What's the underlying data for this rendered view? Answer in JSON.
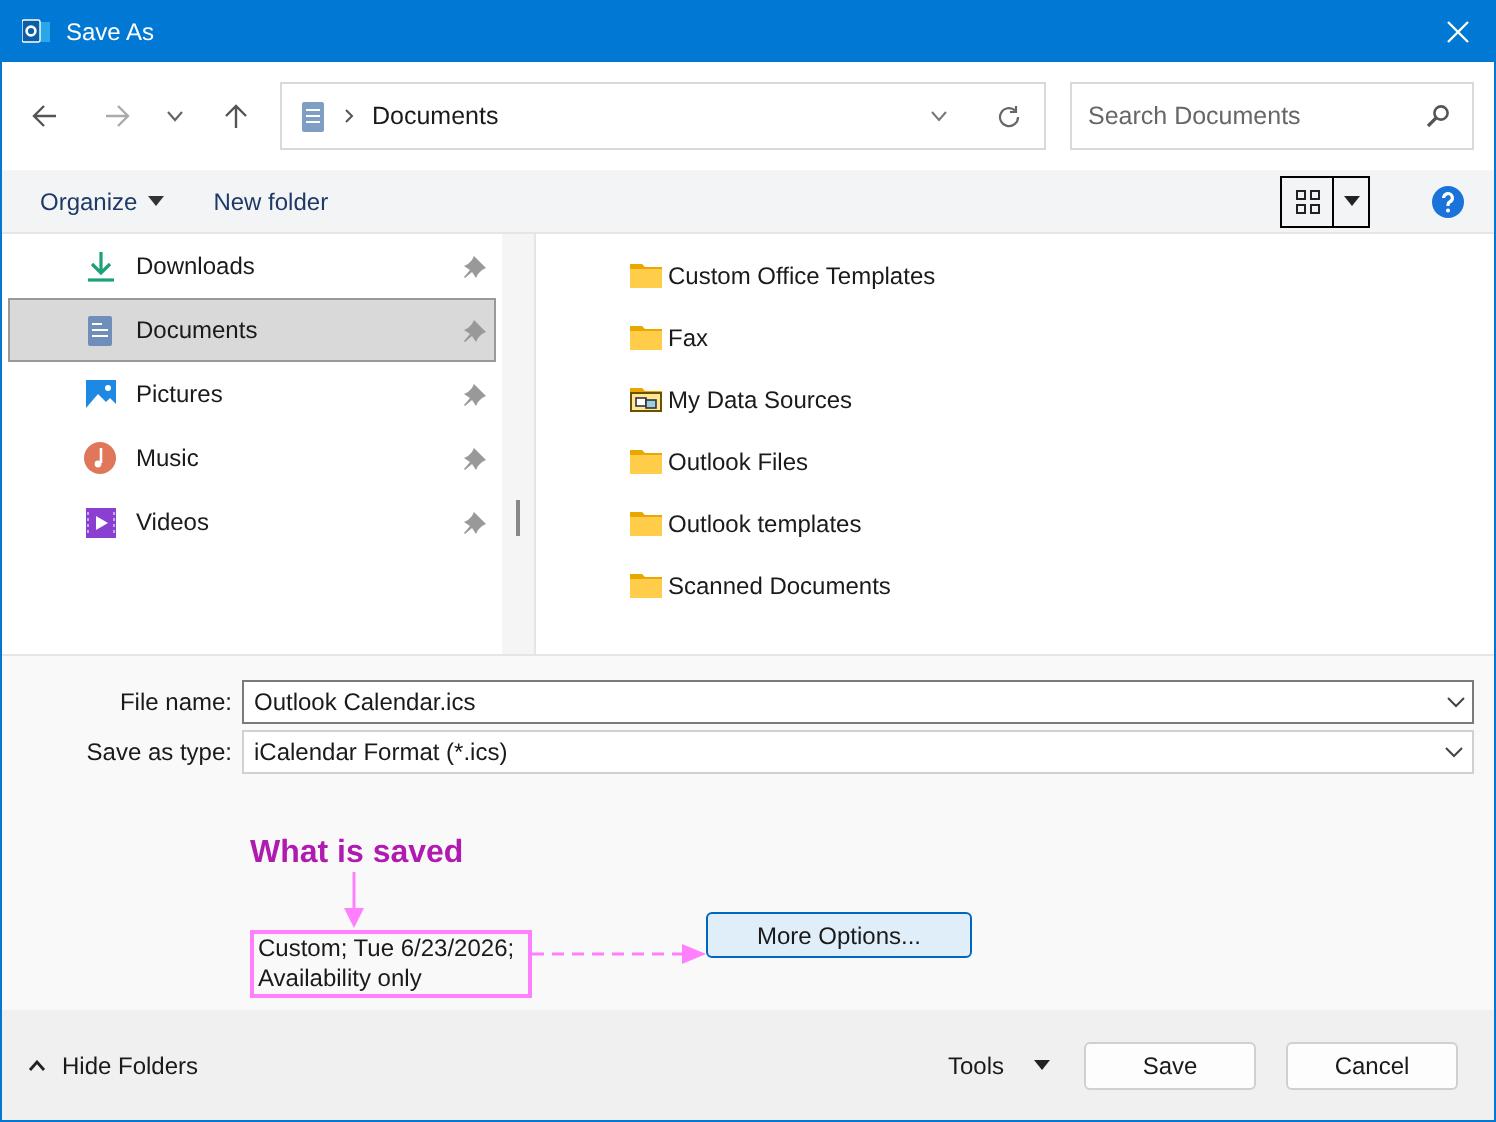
{
  "window": {
    "title": "Save As"
  },
  "address_bar": {
    "path": "Documents"
  },
  "search": {
    "placeholder": "Search Documents"
  },
  "toolbar": {
    "organize": "Organize",
    "new_folder": "New folder"
  },
  "sidebar": {
    "items": [
      {
        "label": "Downloads",
        "kind": "downloads",
        "selected": false
      },
      {
        "label": "Documents",
        "kind": "documents",
        "selected": true
      },
      {
        "label": "Pictures",
        "kind": "pictures",
        "selected": false
      },
      {
        "label": "Music",
        "kind": "music",
        "selected": false
      },
      {
        "label": "Videos",
        "kind": "videos",
        "selected": false
      }
    ]
  },
  "files": [
    {
      "name": "Custom Office Templates",
      "kind": "folder"
    },
    {
      "name": "Fax",
      "kind": "folder"
    },
    {
      "name": "My Data Sources",
      "kind": "data-folder"
    },
    {
      "name": "Outlook Files",
      "kind": "folder"
    },
    {
      "name": "Outlook templates",
      "kind": "folder"
    },
    {
      "name": "Scanned Documents",
      "kind": "folder"
    }
  ],
  "file_name": {
    "label": "File name:",
    "value": "Outlook Calendar.ics"
  },
  "save_as_type": {
    "label": "Save as type:",
    "value": "iCalendar Format (*.ics)"
  },
  "annotation": {
    "text": "What is saved"
  },
  "summary": "Custom; Tue 6/23/2026; Availability only",
  "more_options": "More Options...",
  "footer": {
    "hide_folders": "Hide Folders",
    "tools": "Tools",
    "buttons": [
      "Save",
      "Cancel"
    ]
  }
}
